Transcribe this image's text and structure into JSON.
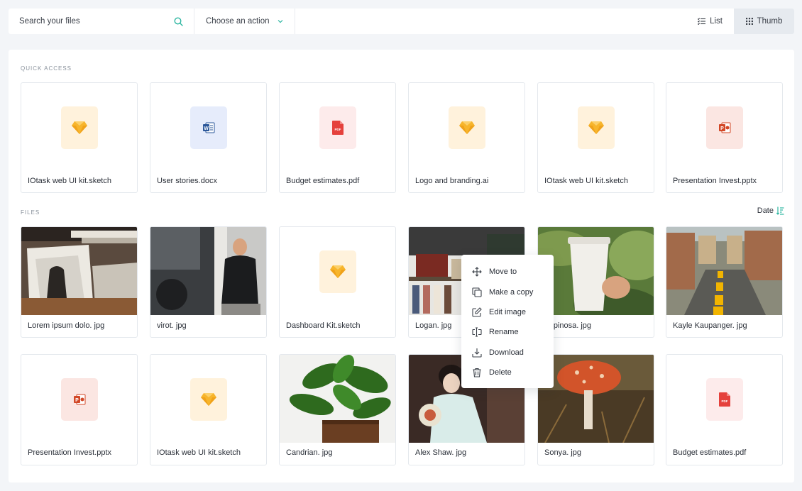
{
  "search": {
    "placeholder": "Search your files"
  },
  "action_select": {
    "label": "Choose an action"
  },
  "view_toggle": {
    "list_label": "List",
    "thumb_label": "Thumb",
    "active": "Thumb"
  },
  "quick_access": {
    "title": "QUICK ACCESS",
    "items": [
      {
        "name": "IOtask web UI kit.sketch",
        "type": "sketch"
      },
      {
        "name": "User stories.docx",
        "type": "word"
      },
      {
        "name": "Budget estimates.pdf",
        "type": "pdf"
      },
      {
        "name": "Logo and branding.ai",
        "type": "sketch"
      },
      {
        "name": "IOtask web UI kit.sketch",
        "type": "sketch"
      },
      {
        "name": "Presentation Invest.pptx",
        "type": "ppt"
      }
    ]
  },
  "files": {
    "title": "FILES",
    "sort_label": "Date",
    "items": [
      {
        "name": "Lorem ipsum dolo. jpg",
        "type": "image"
      },
      {
        "name": "virot. jpg",
        "type": "image"
      },
      {
        "name": "Dashboard Kit.sketch",
        "type": "sketch"
      },
      {
        "name": "Logan. jpg",
        "type": "image"
      },
      {
        "name": "Espinosa. jpg",
        "type": "image"
      },
      {
        "name": "Kayle Kaupanger. jpg",
        "type": "image"
      },
      {
        "name": "Presentation Invest.pptx",
        "type": "ppt"
      },
      {
        "name": "IOtask web UI kit.sketch",
        "type": "sketch"
      },
      {
        "name": "Candrian. jpg",
        "type": "image"
      },
      {
        "name": "Alex Shaw. jpg",
        "type": "image"
      },
      {
        "name": "Sonya. jpg",
        "type": "image"
      },
      {
        "name": "Budget estimates.pdf",
        "type": "pdf"
      }
    ]
  },
  "context_menu": {
    "items": [
      {
        "label": "Move to",
        "icon": "move-icon"
      },
      {
        "label": "Make a copy",
        "icon": "copy-icon"
      },
      {
        "label": "Edit image",
        "icon": "edit-icon"
      },
      {
        "label": "Rename",
        "icon": "rename-icon"
      },
      {
        "label": "Download",
        "icon": "download-icon"
      },
      {
        "label": "Delete",
        "icon": "trash-icon"
      }
    ]
  },
  "colors": {
    "accent": "#2bb5a0",
    "sketch": "#f7b52c",
    "word": "#2b579a",
    "pdf": "#e5413c",
    "ppt": "#d24726"
  }
}
